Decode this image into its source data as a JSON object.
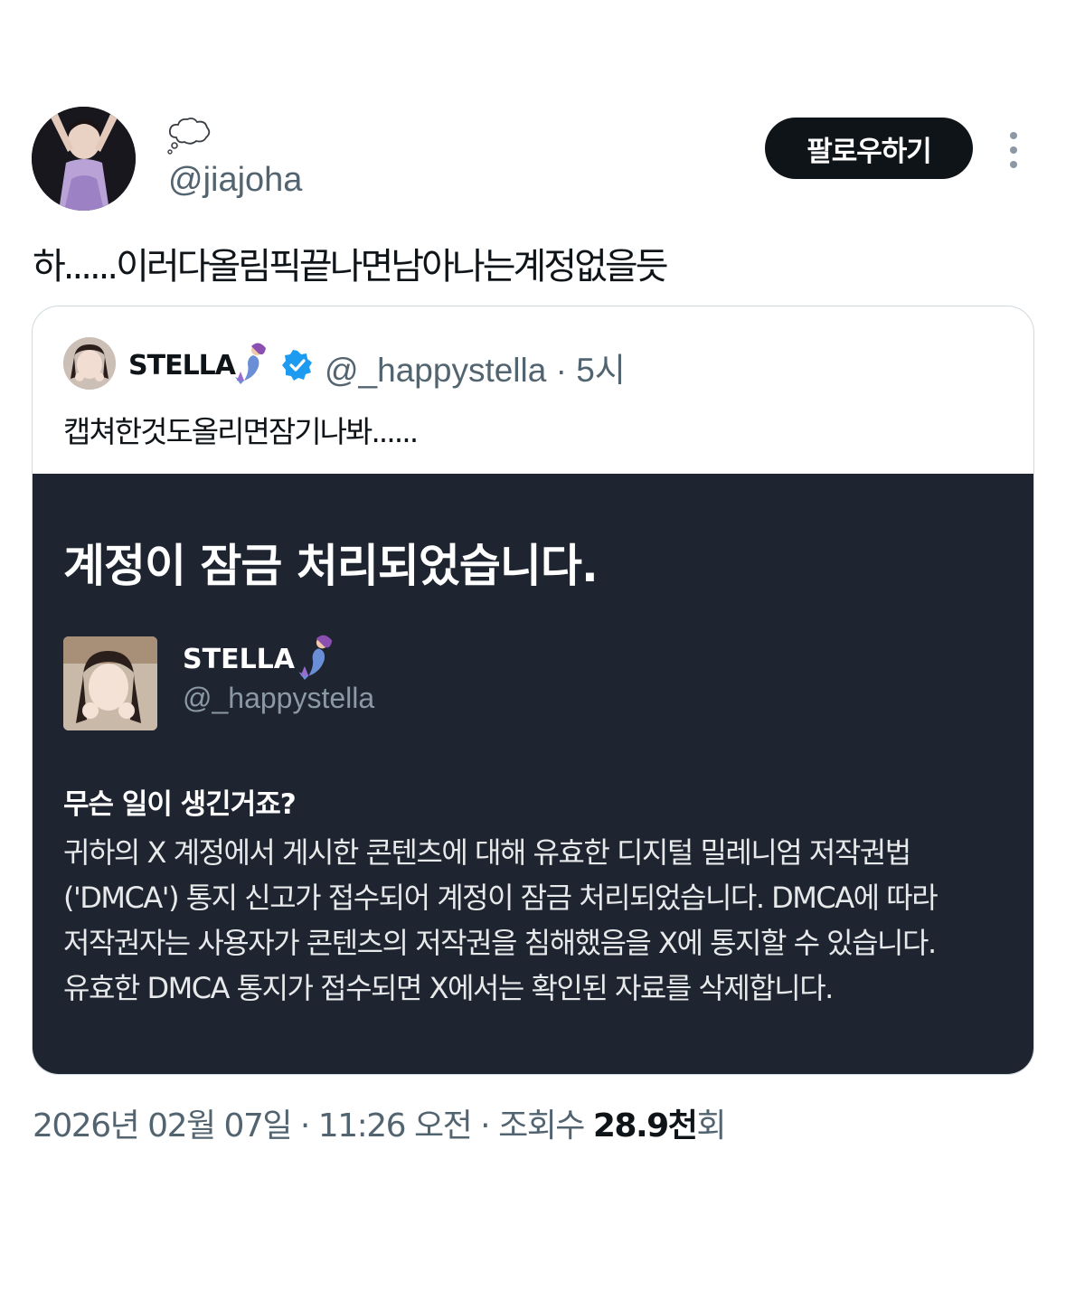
{
  "author": {
    "handle": "@jiajoha",
    "status_icon": "thought-balloon-icon",
    "follow_label": "팔로우하기"
  },
  "tweet": {
    "text": "하......이러다올림픽끝나면남아나는계정없을듯"
  },
  "quote": {
    "name": "STELLA",
    "name_emoji": "mermaid",
    "verified": true,
    "handle": "@_happystella",
    "time": "· 5시",
    "text": "캡쳐한것도올리면잠기나봐......",
    "image": {
      "title": "계정이 잠금 처리되었습니다.",
      "name": "STELLA",
      "handle": "@_happystella",
      "question": "무슨 일이 생긴거죠?",
      "body": "귀하의 X 계정에서 게시한 콘텐츠에 대해 유효한 디지털 밀레니엄 저작권법('DMCA') 통지 신고가 접수되어 계정이 잠금 처리되었습니다. DMCA에 따라 저작권자는 사용자가 콘텐츠의 저작권을 침해했음을 X에 통지할 수 있습니다. 유효한 DMCA 통지가 접수되면 X에서는 확인된 자료를 삭제합니다."
    }
  },
  "meta": {
    "datetime": "2026년 02월 07일 · 11:26 오전 · 조회수 ",
    "views_number": "28.9천",
    "views_suffix": "회"
  },
  "colors": {
    "follow_bg": "#0f1419",
    "secondary_text": "#536471",
    "dark_panel": "#1f2530",
    "verified_blue": "#1d9bf0"
  }
}
